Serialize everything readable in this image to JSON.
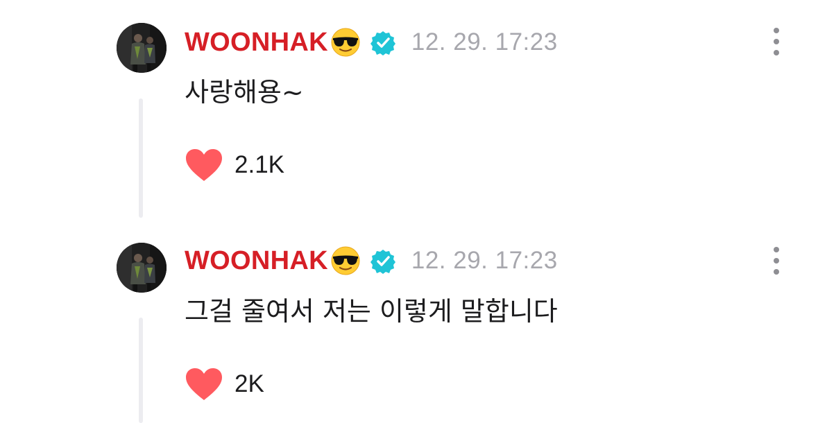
{
  "comments": [
    {
      "username": "WOONHAK",
      "username_emoji": "😎",
      "verified": true,
      "timestamp": "12. 29. 17:23",
      "message": "사랑해용~",
      "likes": "2.1K",
      "avatar_icon": "profile-photo"
    },
    {
      "username": "WOONHAK",
      "username_emoji": "😎",
      "verified": true,
      "timestamp": "12. 29. 17:23",
      "message": "그걸 줄여서 저는 이렇게 말합니다",
      "likes": "2K",
      "avatar_icon": "profile-photo"
    }
  ],
  "colors": {
    "username": "#d61f26",
    "verified_badge": "#1fc4d6",
    "heart": "#ff5a5f",
    "timestamp": "#a7a7ad",
    "thread_line": "#ececf0",
    "text": "#1c1c1e"
  },
  "icons": {
    "verified": "verified-badge-icon",
    "like": "heart-icon",
    "more": "more-vertical-icon",
    "emoji": "sunglasses-emoji-icon"
  }
}
